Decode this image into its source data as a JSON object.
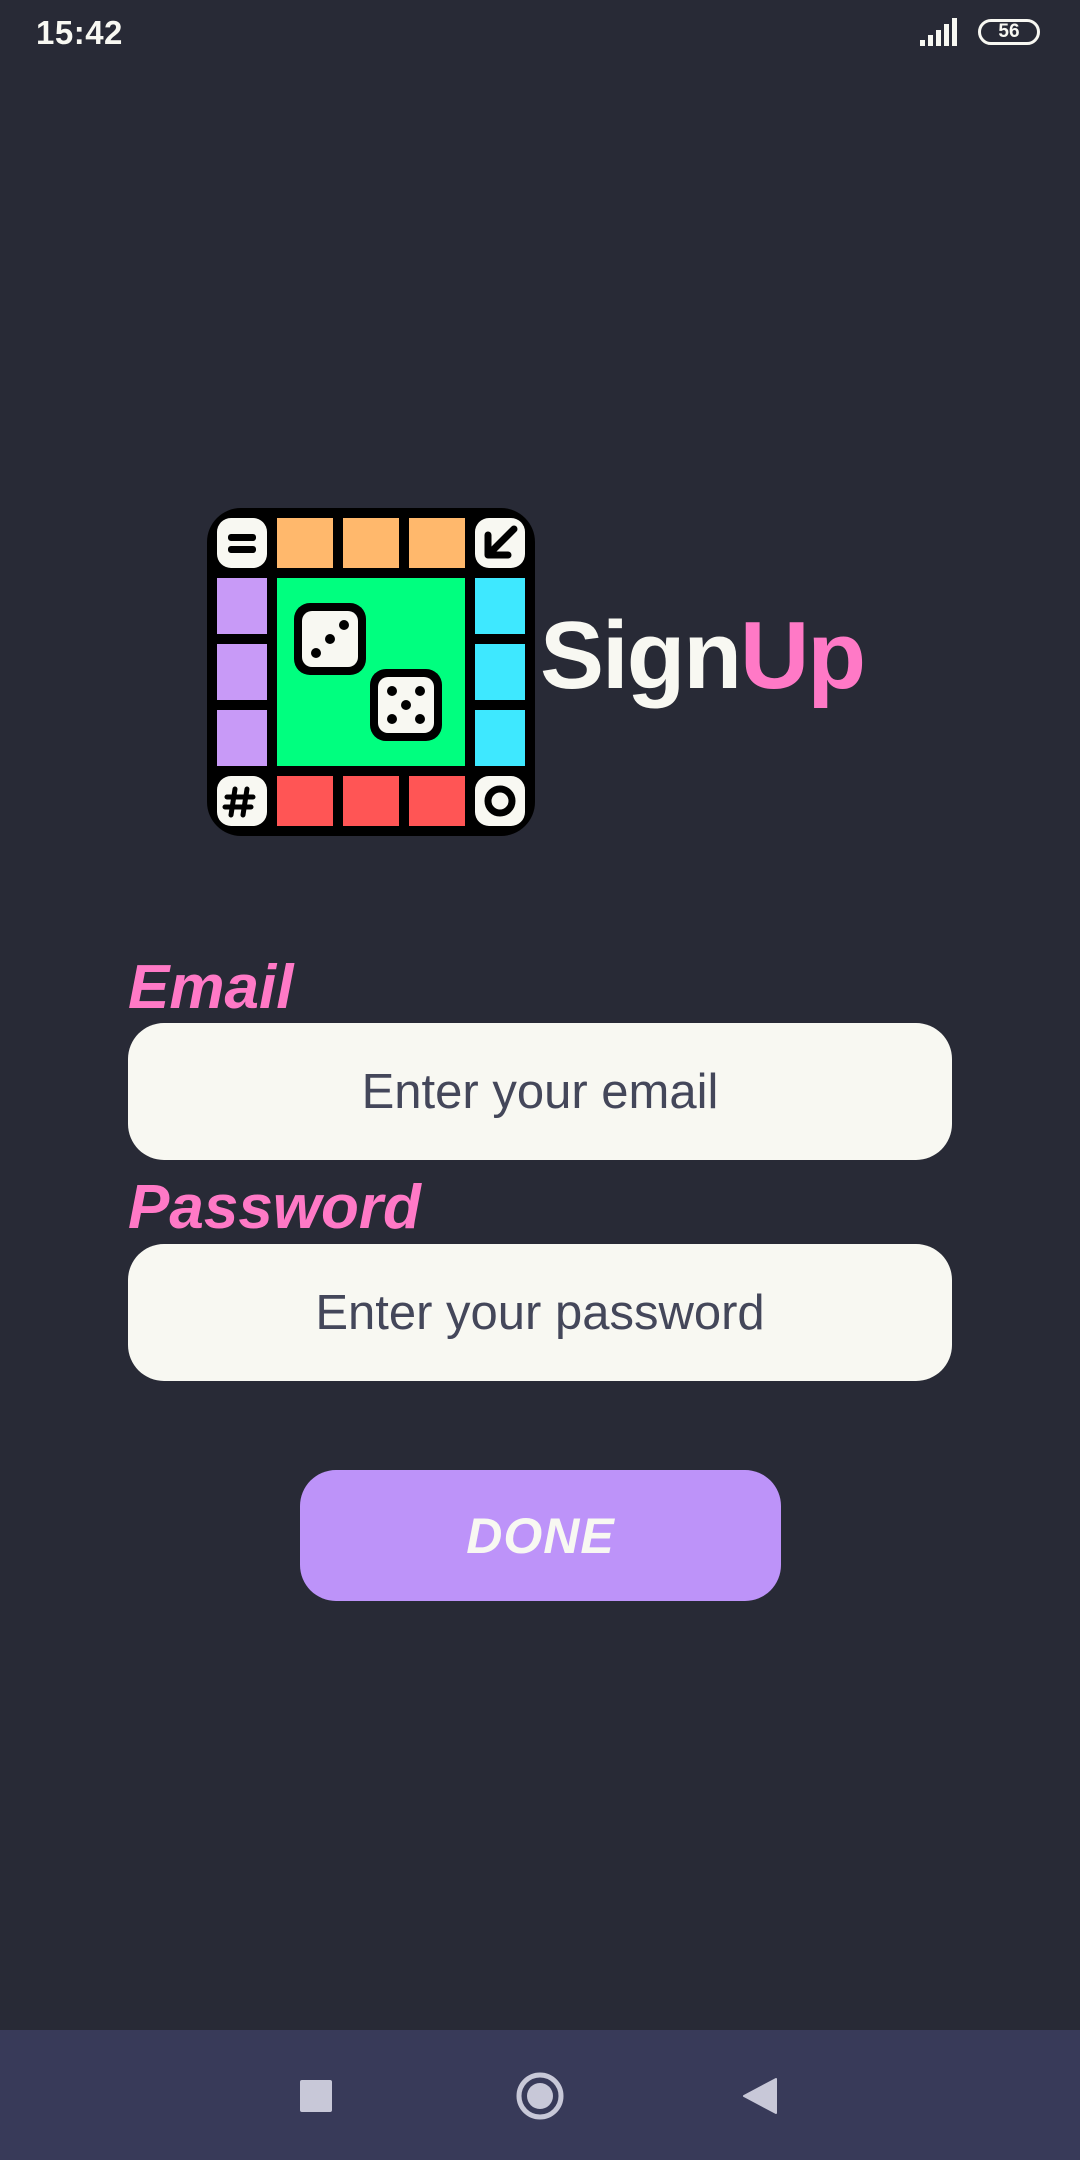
{
  "status_bar": {
    "time": "15:42",
    "battery": "56",
    "signal_icon": "signal-bars-icon"
  },
  "header": {
    "logo_icon": "board-game-icon",
    "title_part1": "Sign",
    "title_part2": "Up"
  },
  "form": {
    "email_label": "Email",
    "email_placeholder": "Enter your email",
    "email_value": "",
    "password_label": "Password",
    "password_placeholder": "Enter your password",
    "password_value": "",
    "submit_label": "DONE"
  },
  "nav_bar": {
    "recents_icon": "square-icon",
    "home_icon": "circle-icon",
    "back_icon": "triangle-back-icon"
  },
  "colors": {
    "background": "#282a36",
    "accent_pink": "#ff79c6",
    "button_purple": "#bd93f9",
    "input_bg": "#f8f8f2",
    "nav_bg": "#383a59"
  }
}
